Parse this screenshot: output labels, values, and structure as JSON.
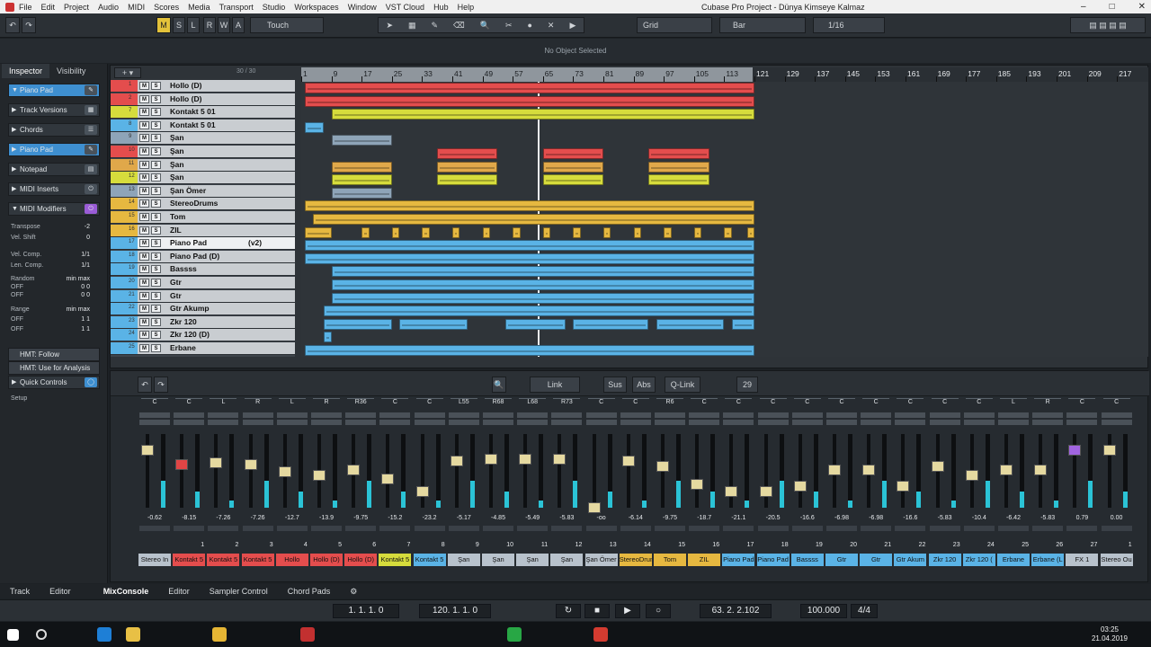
{
  "window": {
    "title": "Cubase Pro Project - Dünya Kimseye Kalmaz",
    "menu": [
      "File",
      "Edit",
      "Project",
      "Audio",
      "MIDI",
      "Scores",
      "Media",
      "Transport",
      "Studio",
      "Workspaces",
      "Window",
      "VST Cloud",
      "Hub",
      "Help"
    ]
  },
  "toolbar": {
    "m": "M",
    "s": "S",
    "l": "L",
    "r": "R",
    "w": "W",
    "a": "A",
    "automation_mode": "Touch",
    "snap_type": "Grid",
    "grid": "Bar",
    "quantize": "1/16"
  },
  "status": "No Object Selected",
  "inspector": {
    "tabs": [
      "Inspector",
      "Visibility"
    ],
    "track": "Piano Pad",
    "sections": [
      "Track Versions",
      "Chords",
      "Piano Pad",
      "Notepad",
      "MIDI Inserts",
      "MIDI Modifiers"
    ],
    "params": [
      {
        "l": "Transpose",
        "v": "-2"
      },
      {
        "l": "Vel. Shift",
        "v": "0"
      },
      {
        "l": "Vel. Comp.",
        "v": "1/1"
      },
      {
        "l": "Len. Comp.",
        "v": "1/1"
      },
      {
        "l": "Random",
        "v": "min max"
      },
      {
        "l": "OFF",
        "v": "0 0"
      },
      {
        "l": "OFF",
        "v": "0 0"
      },
      {
        "l": "Range",
        "v": "min max"
      },
      {
        "l": "OFF",
        "v": "1 1"
      },
      {
        "l": "OFF",
        "v": "1 1"
      }
    ],
    "hmt1": "HMT: Follow",
    "hmt2": "HMT: Use for Analysis",
    "quick": "Quick Controls",
    "setup": "Setup"
  },
  "project": {
    "count": "30 / 30",
    "ruler": [
      "1",
      "9",
      "17",
      "25",
      "33",
      "41",
      "49",
      "57",
      "65",
      "73",
      "81",
      "89",
      "97",
      "105",
      "113",
      "121",
      "129",
      "137",
      "145",
      "153",
      "161",
      "169",
      "177",
      "185",
      "193",
      "201",
      "209",
      "217"
    ],
    "tracks": [
      {
        "n": "1",
        "name": "Hollo (D)",
        "color": "#e44d4d"
      },
      {
        "n": "2",
        "name": "Hollo (D)",
        "color": "#e44d4d"
      },
      {
        "n": "7",
        "name": "Kontakt 5 01",
        "color": "#d6dc3c"
      },
      {
        "n": "8",
        "name": "Kontakt 5 01",
        "color": "#5ab3e6"
      },
      {
        "n": "9",
        "name": "Şan",
        "color": "#8ea4b8"
      },
      {
        "n": "10",
        "name": "Şan",
        "color": "#e44d4d"
      },
      {
        "n": "11",
        "name": "Şan",
        "color": "#e0a84a"
      },
      {
        "n": "12",
        "name": "Şan",
        "color": "#d6dc3c"
      },
      {
        "n": "13",
        "name": "Şan Ömer",
        "color": "#8ea4b8"
      },
      {
        "n": "14",
        "name": "StereoDrums",
        "color": "#e6b840"
      },
      {
        "n": "15",
        "name": "Tom",
        "color": "#e6b840"
      },
      {
        "n": "16",
        "name": "ZIL",
        "color": "#e6b840"
      },
      {
        "n": "17",
        "name": "Piano Pad",
        "color": "#5ab3e6",
        "extra": "(v2)"
      },
      {
        "n": "18",
        "name": "Piano Pad (D)",
        "color": "#5ab3e6"
      },
      {
        "n": "19",
        "name": "Bassss",
        "color": "#5ab3e6"
      },
      {
        "n": "20",
        "name": "Gtr",
        "color": "#5ab3e6"
      },
      {
        "n": "21",
        "name": "Gtr",
        "color": "#5ab3e6"
      },
      {
        "n": "22",
        "name": "Gtr Akump",
        "color": "#5ab3e6"
      },
      {
        "n": "23",
        "name": "Zkr 120",
        "color": "#5ab3e6"
      },
      {
        "n": "24",
        "name": "Zkr 120 (D)",
        "color": "#5ab3e6"
      },
      {
        "n": "25",
        "name": "Erbane",
        "color": "#5ab3e6"
      }
    ]
  },
  "mixer": {
    "tools": [
      "Link",
      "Sus",
      "Abs",
      "Q-Link",
      "29"
    ],
    "strips": [
      {
        "pan": "C",
        "vol": "-0.62",
        "ch": "",
        "label": "Stereo In",
        "color": "#b8c2cc"
      },
      {
        "pan": "C",
        "vol": "-8.15",
        "ch": "1",
        "label": "Kontakt 5",
        "color": "#e44d4d"
      },
      {
        "pan": "L",
        "vol": "-7.26",
        "ch": "2",
        "label": "Kontakt 5",
        "color": "#e44d4d"
      },
      {
        "pan": "R",
        "vol": "-7.26",
        "ch": "3",
        "label": "Kontakt 5",
        "color": "#e44d4d"
      },
      {
        "pan": "L",
        "vol": "-12.7",
        "ch": "4",
        "label": "Hollo",
        "color": "#e44d4d"
      },
      {
        "pan": "R",
        "vol": "-13.9",
        "ch": "5",
        "label": "Hollo (D)",
        "color": "#e44d4d"
      },
      {
        "pan": "R36",
        "vol": "-9.75",
        "ch": "6",
        "label": "Hollo (D)",
        "color": "#e44d4d"
      },
      {
        "pan": "C",
        "vol": "-15.2",
        "ch": "7",
        "label": "Kontakt 5",
        "color": "#d6dc3c"
      },
      {
        "pan": "C",
        "vol": "-23.2",
        "ch": "8",
        "label": "Kontakt 5",
        "color": "#5ab3e6"
      },
      {
        "pan": "L55",
        "vol": "-5.17",
        "ch": "9",
        "label": "Şan",
        "color": "#b8c2cc"
      },
      {
        "pan": "R68",
        "vol": "-4.85",
        "ch": "10",
        "label": "Şan",
        "color": "#b8c2cc"
      },
      {
        "pan": "L68",
        "vol": "-5.49",
        "ch": "11",
        "label": "Şan",
        "color": "#b8c2cc"
      },
      {
        "pan": "R73",
        "vol": "-5.83",
        "ch": "12",
        "label": "Şan",
        "color": "#b8c2cc"
      },
      {
        "pan": "C",
        "vol": "-oo",
        "ch": "13",
        "label": "Şan Ömer",
        "color": "#b8c2cc"
      },
      {
        "pan": "C",
        "vol": "-6.14",
        "ch": "14",
        "label": "StereoDrums",
        "color": "#e6b840"
      },
      {
        "pan": "R6",
        "vol": "-9.75",
        "ch": "15",
        "label": "Tom",
        "color": "#e6b840"
      },
      {
        "pan": "C",
        "vol": "-18.7",
        "ch": "16",
        "label": "ZIL",
        "color": "#e6b840"
      },
      {
        "pan": "C",
        "vol": "-21.1",
        "ch": "17",
        "label": "Piano Pad",
        "color": "#5ab3e6"
      },
      {
        "pan": "C",
        "vol": "-20.5",
        "ch": "18",
        "label": "Piano Pad",
        "color": "#5ab3e6"
      },
      {
        "pan": "C",
        "vol": "-16.6",
        "ch": "19",
        "label": "Bassss",
        "color": "#5ab3e6"
      },
      {
        "pan": "C",
        "vol": "-6.98",
        "ch": "20",
        "label": "Gtr",
        "color": "#5ab3e6"
      },
      {
        "pan": "C",
        "vol": "-6.98",
        "ch": "21",
        "label": "Gtr",
        "color": "#5ab3e6"
      },
      {
        "pan": "C",
        "vol": "-16.6",
        "ch": "22",
        "label": "Gtr Akum",
        "color": "#5ab3e6"
      },
      {
        "pan": "C",
        "vol": "-5.83",
        "ch": "23",
        "label": "Zkr 120",
        "color": "#5ab3e6"
      },
      {
        "pan": "C",
        "vol": "-10.4",
        "ch": "24",
        "label": "Zkr 120 (",
        "color": "#5ab3e6"
      },
      {
        "pan": "L",
        "vol": "-6.42",
        "ch": "25",
        "label": "Erbane",
        "color": "#5ab3e6"
      },
      {
        "pan": "R",
        "vol": "-5.83",
        "ch": "26",
        "label": "Erbane (L",
        "color": "#5ab3e6"
      },
      {
        "pan": "C",
        "vol": "0.79",
        "ch": "27",
        "label": "FX 1",
        "color": "#b8c2cc"
      },
      {
        "pan": "C",
        "vol": "0.00",
        "ch": "1",
        "label": "Stereo Ou",
        "color": "#b8c2cc"
      }
    ]
  },
  "lower_tabs": [
    "Track",
    "Editor",
    "MixConsole",
    "Editor",
    "Sampler Control",
    "Chord Pads"
  ],
  "transport": {
    "left": "1. 1. 1. 0",
    "right": "120. 1. 1. 0",
    "position": "63. 2. 2.102",
    "tempo": "100.000",
    "signature": "4/4"
  },
  "clock": {
    "time": "03:25",
    "date": "21.04.2019"
  }
}
